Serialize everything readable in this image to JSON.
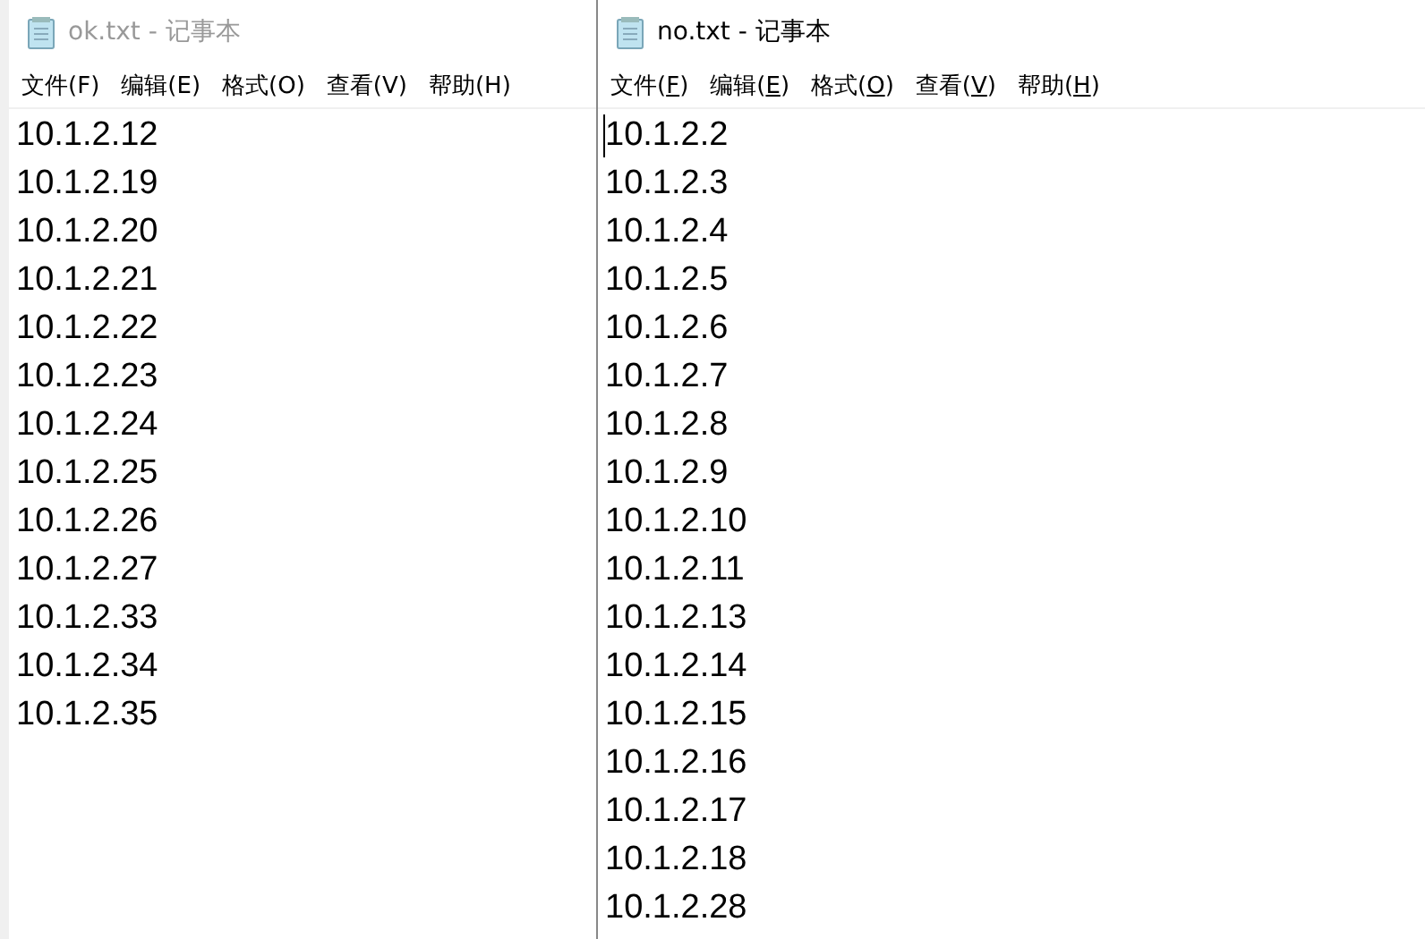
{
  "windows": [
    {
      "title": "ok.txt - 记事本",
      "active": false,
      "menu": [
        "文件(F)",
        "编辑(E)",
        "格式(O)",
        "查看(V)",
        "帮助(H)"
      ],
      "caret": false,
      "lines": [
        "10.1.2.12",
        "10.1.2.19",
        "10.1.2.20",
        "10.1.2.21",
        "10.1.2.22",
        "10.1.2.23",
        "10.1.2.24",
        "10.1.2.25",
        "10.1.2.26",
        "10.1.2.27",
        "10.1.2.33",
        "10.1.2.34",
        "10.1.2.35"
      ]
    },
    {
      "title": "no.txt - 记事本",
      "active": true,
      "menu": [
        "文件(F)",
        "编辑(E)",
        "格式(O)",
        "查看(V)",
        "帮助(H)"
      ],
      "caret": true,
      "lines": [
        "10.1.2.2",
        "10.1.2.3",
        "10.1.2.4",
        "10.1.2.5",
        "10.1.2.6",
        "10.1.2.7",
        "10.1.2.8",
        "10.1.2.9",
        "10.1.2.10",
        "10.1.2.11",
        "10.1.2.13",
        "10.1.2.14",
        "10.1.2.15",
        "10.1.2.16",
        "10.1.2.17",
        "10.1.2.18",
        "10.1.2.28"
      ]
    }
  ]
}
